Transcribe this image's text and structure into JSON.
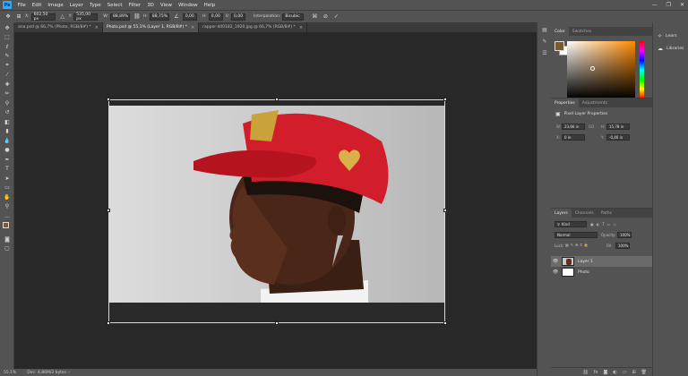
{
  "app": {
    "logo": "Ps"
  },
  "menu": [
    "File",
    "Edit",
    "Image",
    "Layer",
    "Type",
    "Select",
    "Filter",
    "3D",
    "View",
    "Window",
    "Help"
  ],
  "window_controls": {
    "minimize": "—",
    "maximize": "❐",
    "close": "✕"
  },
  "options": {
    "x_label": "X:",
    "x_value": "602,50 px",
    "y_label": "Y:",
    "y_value": "535,00 px",
    "w_label": "W:",
    "w_value": "88,89%",
    "h_label": "H:",
    "h_value": "88,75%",
    "angle_value": "0,00",
    "hskew_label": "H:",
    "hskew_value": "0,00",
    "vskew_label": "V:",
    "vskew_value": "0,00",
    "interp_label": "Interpolation:",
    "interp_value": "Bicubic"
  },
  "tabs": [
    {
      "label": "ana.psd @ 66,7% (Photo, RGB/8#) *",
      "close": "×"
    },
    {
      "label": "Photo.psd @ 55,1% (Layer 1, RGB/8#) *",
      "close": "×"
    },
    {
      "label": "rapper-440182_1920.jpg @ 66,7% (RGB/8#) *",
      "close": "×"
    }
  ],
  "statusbar": {
    "zoom": "55,1%",
    "doc": "Doc: 4,86M/2 bytes"
  },
  "right_column": {
    "learn": "Learn",
    "libraries": "Libraries"
  },
  "color_panel": {
    "tab_color": "Color",
    "tab_swatches": "Swatches",
    "fg": "#7a5a2e",
    "bg": "#ffffff"
  },
  "properties_panel": {
    "tab_properties": "Properties",
    "tab_adjustments": "Adjustments",
    "title": "Pixel Layer Properties",
    "w_label": "W:",
    "w_value": "23,66 in",
    "link_label": "GO",
    "h_label": "H:",
    "h_value": "15,78 in",
    "x_label": "X:",
    "x_value": "0 in",
    "y_label": "Y:",
    "y_value": "-0,46 in"
  },
  "layers_panel": {
    "tab_layers": "Layers",
    "tab_channels": "Channels",
    "tab_paths": "Paths",
    "filter_label": "Kind",
    "blend_mode": "Normal",
    "opacity_label": "Opacity:",
    "opacity_value": "100%",
    "lock_label": "Lock:",
    "fill_label": "Fill:",
    "fill_value": "100%",
    "layers": [
      {
        "name": "Layer 1",
        "visible": true,
        "selected": true
      },
      {
        "name": "Photo",
        "visible": true,
        "selected": false
      }
    ],
    "footer_icons": [
      "link-icon",
      "fx-icon",
      "mask-icon",
      "adjustment-icon",
      "folder-icon",
      "new-layer-icon",
      "trash-icon"
    ]
  }
}
